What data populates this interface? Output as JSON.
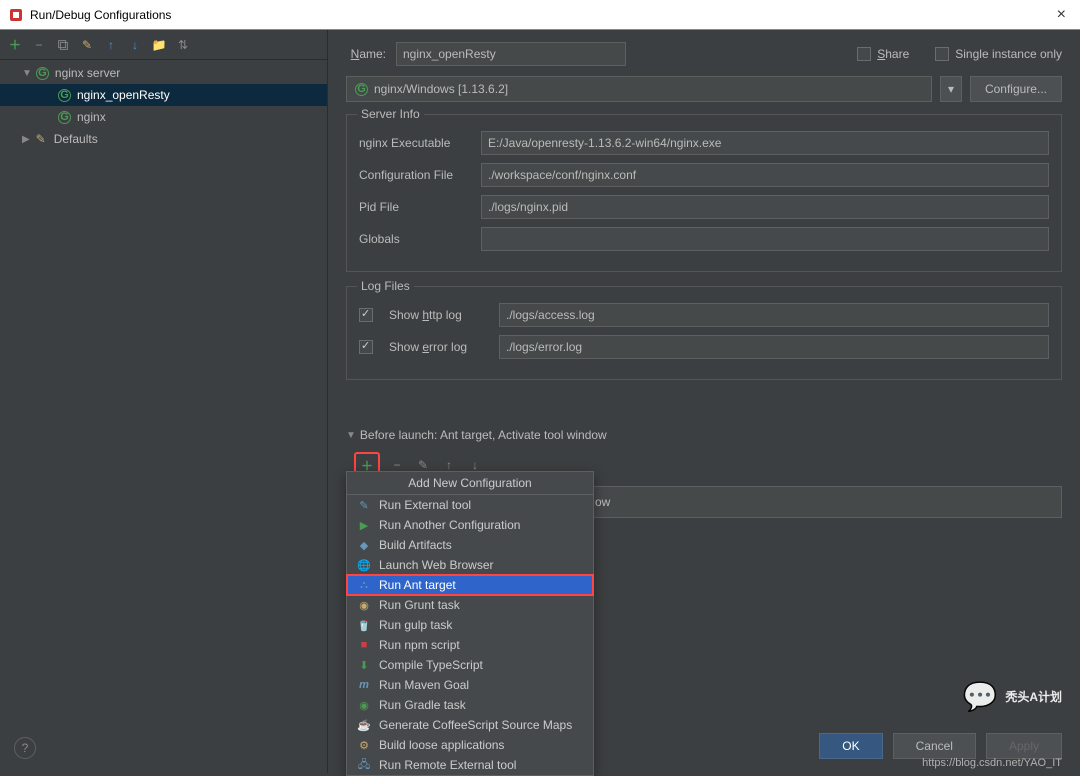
{
  "window": {
    "title": "Run/Debug Configurations"
  },
  "tree": {
    "root": "nginx server",
    "items": [
      "nginx_openResty",
      "nginx"
    ],
    "defaults": "Defaults"
  },
  "form": {
    "name_label": "Name:",
    "name_value": "nginx_openResty",
    "share_label": "Share",
    "single_instance_label": "Single instance only",
    "server_select": "nginx/Windows [1.13.6.2]",
    "configure_btn": "Configure...",
    "server_info_legend": "Server Info",
    "nginx_exe_label": "nginx Executable",
    "nginx_exe_value": "E:/Java/openresty-1.13.6.2-win64/nginx.exe",
    "conf_file_label": "Configuration File",
    "conf_file_value": "./workspace/conf/nginx.conf",
    "pid_file_label": "Pid File",
    "pid_file_value": "./logs/nginx.pid",
    "globals_label": "Globals",
    "globals_value": "",
    "log_files_legend": "Log Files",
    "http_log_label": "Show http log",
    "http_log_value": "./logs/access.log",
    "error_log_label": "Show error log",
    "error_log_value": "./logs/error.log",
    "before_launch_header": "Before launch: Ant target, Activate tool window",
    "activate_label": "ow"
  },
  "popup": {
    "header": "Add New Configuration",
    "items": [
      "Run External tool",
      "Run Another Configuration",
      "Build Artifacts",
      "Launch Web Browser",
      "Run Ant target",
      "Run Grunt task",
      "Run gulp task",
      "Run npm script",
      "Compile TypeScript",
      "Run Maven Goal",
      "Run Gradle task",
      "Generate CoffeeScript Source Maps",
      "Build loose applications",
      "Run Remote External tool"
    ]
  },
  "buttons": {
    "ok": "OK",
    "cancel": "Cancel",
    "apply": "Apply"
  },
  "watermark": {
    "logo": "秃头A计划",
    "url": "https://blog.csdn.net/YAO_IT"
  }
}
